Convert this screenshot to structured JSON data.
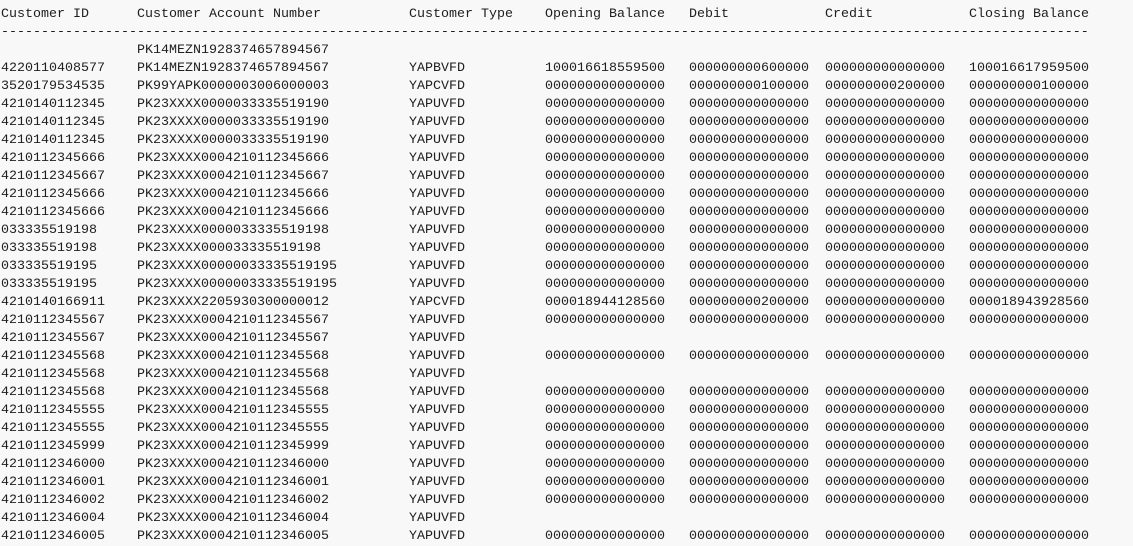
{
  "report": {
    "headers": {
      "customer_id": "Customer ID",
      "account_number": "Customer Account Number",
      "customer_type": "Customer Type",
      "opening_balance": "Opening Balance",
      "debit": "Debit",
      "credit": "Credit",
      "closing_balance": "Closing Balance"
    },
    "separator": "--------------------------------------------------------------------------------------------------------------------------------------------",
    "rows": [
      {
        "id": "",
        "account": "PK14MEZN1928374657894567",
        "type": "",
        "opening": "",
        "debit": "",
        "credit": "",
        "closing": ""
      },
      {
        "id": "4220110408577",
        "account": "PK14MEZN1928374657894567",
        "type": "YAPBVFD",
        "opening": "100016618559500",
        "debit": "000000000600000",
        "credit": "000000000000000",
        "closing": "100016617959500"
      },
      {
        "id": "3520179534535",
        "account": "PK99YAPK0000003006000003",
        "type": "YAPCVFD",
        "opening": "000000000000000",
        "debit": "000000000100000",
        "credit": "000000000200000",
        "closing": "000000000100000"
      },
      {
        "id": "4210140112345",
        "account": "PK23XXXX0000033335519190",
        "type": "YAPUVFD",
        "opening": "000000000000000",
        "debit": "000000000000000",
        "credit": "000000000000000",
        "closing": "000000000000000"
      },
      {
        "id": "4210140112345",
        "account": "PK23XXXX0000033335519190",
        "type": "YAPUVFD",
        "opening": "000000000000000",
        "debit": "000000000000000",
        "credit": "000000000000000",
        "closing": "000000000000000"
      },
      {
        "id": "4210140112345",
        "account": "PK23XXXX0000033335519190",
        "type": "YAPUVFD",
        "opening": "000000000000000",
        "debit": "000000000000000",
        "credit": "000000000000000",
        "closing": "000000000000000"
      },
      {
        "id": "4210112345666",
        "account": "PK23XXXX0004210112345666",
        "type": "YAPUVFD",
        "opening": "000000000000000",
        "debit": "000000000000000",
        "credit": "000000000000000",
        "closing": "000000000000000"
      },
      {
        "id": "4210112345667",
        "account": "PK23XXXX0004210112345667",
        "type": "YAPUVFD",
        "opening": "000000000000000",
        "debit": "000000000000000",
        "credit": "000000000000000",
        "closing": "000000000000000"
      },
      {
        "id": "4210112345666",
        "account": "PK23XXXX0004210112345666",
        "type": "YAPUVFD",
        "opening": "000000000000000",
        "debit": "000000000000000",
        "credit": "000000000000000",
        "closing": "000000000000000"
      },
      {
        "id": "4210112345666",
        "account": "PK23XXXX0004210112345666",
        "type": "YAPUVFD",
        "opening": "000000000000000",
        "debit": "000000000000000",
        "credit": "000000000000000",
        "closing": "000000000000000"
      },
      {
        "id": "033335519198",
        "account": "PK23XXXX0000033335519198",
        "type": "YAPUVFD",
        "opening": "000000000000000",
        "debit": "000000000000000",
        "credit": "000000000000000",
        "closing": "000000000000000"
      },
      {
        "id": "033335519198",
        "account": "PK23XXXX000033335519198",
        "type": "YAPUVFD",
        "opening": "000000000000000",
        "debit": "000000000000000",
        "credit": "000000000000000",
        "closing": "000000000000000"
      },
      {
        "id": "033335519195",
        "account": "PK23XXXX00000033335519195",
        "type": "YAPUVFD",
        "opening": "000000000000000",
        "debit": "000000000000000",
        "credit": "000000000000000",
        "closing": "000000000000000"
      },
      {
        "id": "033335519195",
        "account": "PK23XXXX00000033335519195",
        "type": "YAPUVFD",
        "opening": "000000000000000",
        "debit": "000000000000000",
        "credit": "000000000000000",
        "closing": "000000000000000"
      },
      {
        "id": "4210140166911",
        "account": "PK23XXXX2205930300000012",
        "type": "YAPCVFD",
        "opening": "000018944128560",
        "debit": "000000000200000",
        "credit": "000000000000000",
        "closing": "000018943928560"
      },
      {
        "id": "4210112345567",
        "account": "PK23XXXX0004210112345567",
        "type": "YAPUVFD",
        "opening": "000000000000000",
        "debit": "000000000000000",
        "credit": "000000000000000",
        "closing": "000000000000000"
      },
      {
        "id": "4210112345567",
        "account": "PK23XXXX0004210112345567",
        "type": "YAPUVFD",
        "opening": "",
        "debit": "",
        "credit": "",
        "closing": ""
      },
      {
        "id": "4210112345568",
        "account": "PK23XXXX0004210112345568",
        "type": "YAPUVFD",
        "opening": "000000000000000",
        "debit": "000000000000000",
        "credit": "000000000000000",
        "closing": "000000000000000"
      },
      {
        "id": "4210112345568",
        "account": "PK23XXXX0004210112345568",
        "type": "YAPUVFD",
        "opening": "",
        "debit": "",
        "credit": "",
        "closing": ""
      },
      {
        "id": "4210112345568",
        "account": "PK23XXXX0004210112345568",
        "type": "YAPUVFD",
        "opening": "000000000000000",
        "debit": "000000000000000",
        "credit": "000000000000000",
        "closing": "000000000000000"
      },
      {
        "id": "4210112345555",
        "account": "PK23XXXX0004210112345555",
        "type": "YAPUVFD",
        "opening": "000000000000000",
        "debit": "000000000000000",
        "credit": "000000000000000",
        "closing": "000000000000000"
      },
      {
        "id": "4210112345555",
        "account": "PK23XXXX0004210112345555",
        "type": "YAPUVFD",
        "opening": "000000000000000",
        "debit": "000000000000000",
        "credit": "000000000000000",
        "closing": "000000000000000"
      },
      {
        "id": "4210112345999",
        "account": "PK23XXXX0004210112345999",
        "type": "YAPUVFD",
        "opening": "000000000000000",
        "debit": "000000000000000",
        "credit": "000000000000000",
        "closing": "000000000000000"
      },
      {
        "id": "4210112346000",
        "account": "PK23XXXX0004210112346000",
        "type": "YAPUVFD",
        "opening": "000000000000000",
        "debit": "000000000000000",
        "credit": "000000000000000",
        "closing": "000000000000000"
      },
      {
        "id": "4210112346001",
        "account": "PK23XXXX0004210112346001",
        "type": "YAPUVFD",
        "opening": "000000000000000",
        "debit": "000000000000000",
        "credit": "000000000000000",
        "closing": "000000000000000"
      },
      {
        "id": "4210112346002",
        "account": "PK23XXXX0004210112346002",
        "type": "YAPUVFD",
        "opening": "000000000000000",
        "debit": "000000000000000",
        "credit": "000000000000000",
        "closing": "000000000000000"
      },
      {
        "id": "4210112346004",
        "account": "PK23XXXX0004210112346004",
        "type": "YAPUVFD",
        "opening": "",
        "debit": "",
        "credit": "",
        "closing": ""
      },
      {
        "id": "4210112346005",
        "account": "PK23XXXX0004210112346005",
        "type": "YAPUVFD",
        "opening": "000000000000000",
        "debit": "000000000000000",
        "credit": "000000000000000",
        "closing": "000000000000000"
      }
    ]
  }
}
